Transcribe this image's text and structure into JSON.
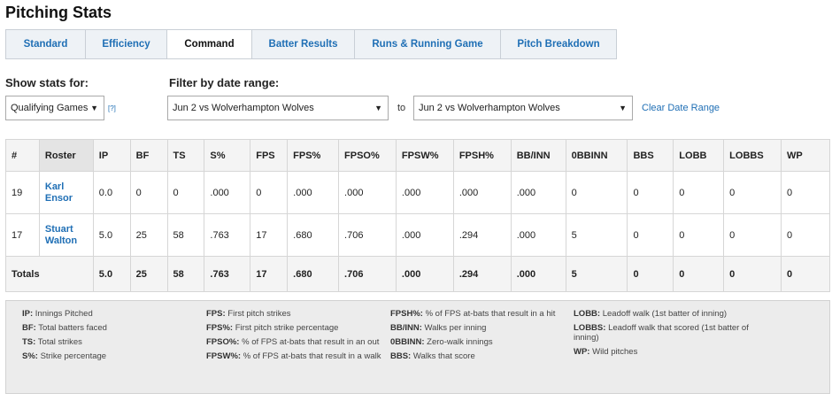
{
  "page": {
    "title": "Pitching Stats"
  },
  "tabs": [
    {
      "label": "Standard"
    },
    {
      "label": "Efficiency"
    },
    {
      "label": "Command",
      "active": true
    },
    {
      "label": "Batter Results"
    },
    {
      "label": "Runs & Running Game"
    },
    {
      "label": "Pitch Breakdown"
    }
  ],
  "filters": {
    "show_stats_label": "Show stats for:",
    "show_stats_value": "Qualifying Games",
    "help_link": "[?]",
    "date_range_label": "Filter by date range:",
    "date_from": "Jun 2 vs Wolverhampton Wolves",
    "to_label": "to",
    "date_to": "Jun 2 vs Wolverhampton Wolves",
    "clear_label": "Clear Date Range"
  },
  "table": {
    "headers": [
      "#",
      "Roster",
      "IP",
      "BF",
      "TS",
      "S%",
      "FPS",
      "FPS%",
      "FPSO%",
      "FPSW%",
      "FPSH%",
      "BB/INN",
      "0BBINN",
      "BBS",
      "LOBB",
      "LOBBS",
      "WP"
    ],
    "rows": [
      {
        "num": "19",
        "first": "Karl",
        "last": "Ensor",
        "stats": [
          "0.0",
          "0",
          "0",
          ".000",
          "0",
          ".000",
          ".000",
          ".000",
          ".000",
          ".000",
          "0",
          "0",
          "0",
          "0",
          "0"
        ]
      },
      {
        "num": "17",
        "first": "Stuart",
        "last": "Walton",
        "stats": [
          "5.0",
          "25",
          "58",
          ".763",
          "17",
          ".680",
          ".706",
          ".000",
          ".294",
          ".000",
          "5",
          "0",
          "0",
          "0",
          "0"
        ]
      }
    ],
    "totals": {
      "label": "Totals",
      "stats": [
        "5.0",
        "25",
        "58",
        ".763",
        "17",
        ".680",
        ".706",
        ".000",
        ".294",
        ".000",
        "5",
        "0",
        "0",
        "0",
        "0"
      ]
    }
  },
  "legend": {
    "col1": [
      {
        "abbr": "IP:",
        "desc": "Innings Pitched"
      },
      {
        "abbr": "BF:",
        "desc": "Total batters faced"
      },
      {
        "abbr": "TS:",
        "desc": "Total strikes"
      },
      {
        "abbr": "S%:",
        "desc": "Strike percentage"
      }
    ],
    "col2": [
      {
        "abbr": "FPS:",
        "desc": "First pitch strikes"
      },
      {
        "abbr": "FPS%:",
        "desc": "First pitch strike percentage"
      },
      {
        "abbr": "FPSO%:",
        "desc": "% of FPS at-bats that result in an out"
      },
      {
        "abbr": "FPSW%:",
        "desc": "% of FPS at-bats that result in a walk"
      }
    ],
    "col3": [
      {
        "abbr": "FPSH%:",
        "desc": "% of FPS at-bats that result in a hit"
      },
      {
        "abbr": "BB/INN:",
        "desc": "Walks per inning"
      },
      {
        "abbr": "0BBINN:",
        "desc": "Zero-walk innings"
      },
      {
        "abbr": "BBS:",
        "desc": "Walks that score"
      }
    ],
    "col4": [
      {
        "abbr": "LOBB:",
        "desc": "Leadoff walk (1st batter of inning)"
      },
      {
        "abbr": "LOBBS:",
        "desc": "Leadoff walk that scored (1st batter of inning)"
      },
      {
        "abbr": "WP:",
        "desc": "Wild pitches"
      }
    ]
  }
}
